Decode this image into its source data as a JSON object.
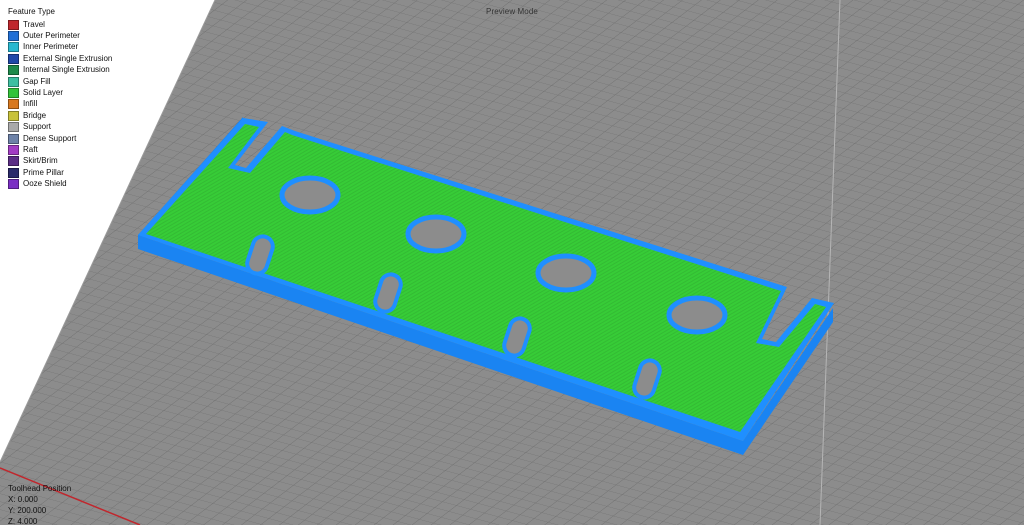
{
  "mode": "Preview Mode",
  "legend": {
    "title": "Feature Type",
    "items": [
      {
        "label": "Travel",
        "color": "#c0272d"
      },
      {
        "label": "Outer Perimeter",
        "color": "#1f6fd6"
      },
      {
        "label": "Inner Perimeter",
        "color": "#28b8d0"
      },
      {
        "label": "External Single Extrusion",
        "color": "#1f48a8"
      },
      {
        "label": "Internal Single Extrusion",
        "color": "#1e8a4a"
      },
      {
        "label": "Gap Fill",
        "color": "#3cbfa0"
      },
      {
        "label": "Solid Layer",
        "color": "#33c33a"
      },
      {
        "label": "Infill",
        "color": "#d8781e"
      },
      {
        "label": "Bridge",
        "color": "#c8c23a"
      },
      {
        "label": "Support",
        "color": "#a9a9a9"
      },
      {
        "label": "Dense Support",
        "color": "#6d82a8"
      },
      {
        "label": "Raft",
        "color": "#a23cc4"
      },
      {
        "label": "Skirt/Brim",
        "color": "#5b2e86"
      },
      {
        "label": "Prime Pillar",
        "color": "#2a2a6a"
      },
      {
        "label": "Ooze Shield",
        "color": "#7a2fc4"
      }
    ]
  },
  "toolhead": {
    "title": "Toolhead Position",
    "x": "X: 0.000",
    "y": "Y: 200.000",
    "z": "Z: 4.000"
  },
  "colors": {
    "bed": "#8c8c8c",
    "grid": "#6f6f6f",
    "part_top": "#3ad23a",
    "part_perimeter": "#1f8fff",
    "travel_line": "#c0272d"
  }
}
